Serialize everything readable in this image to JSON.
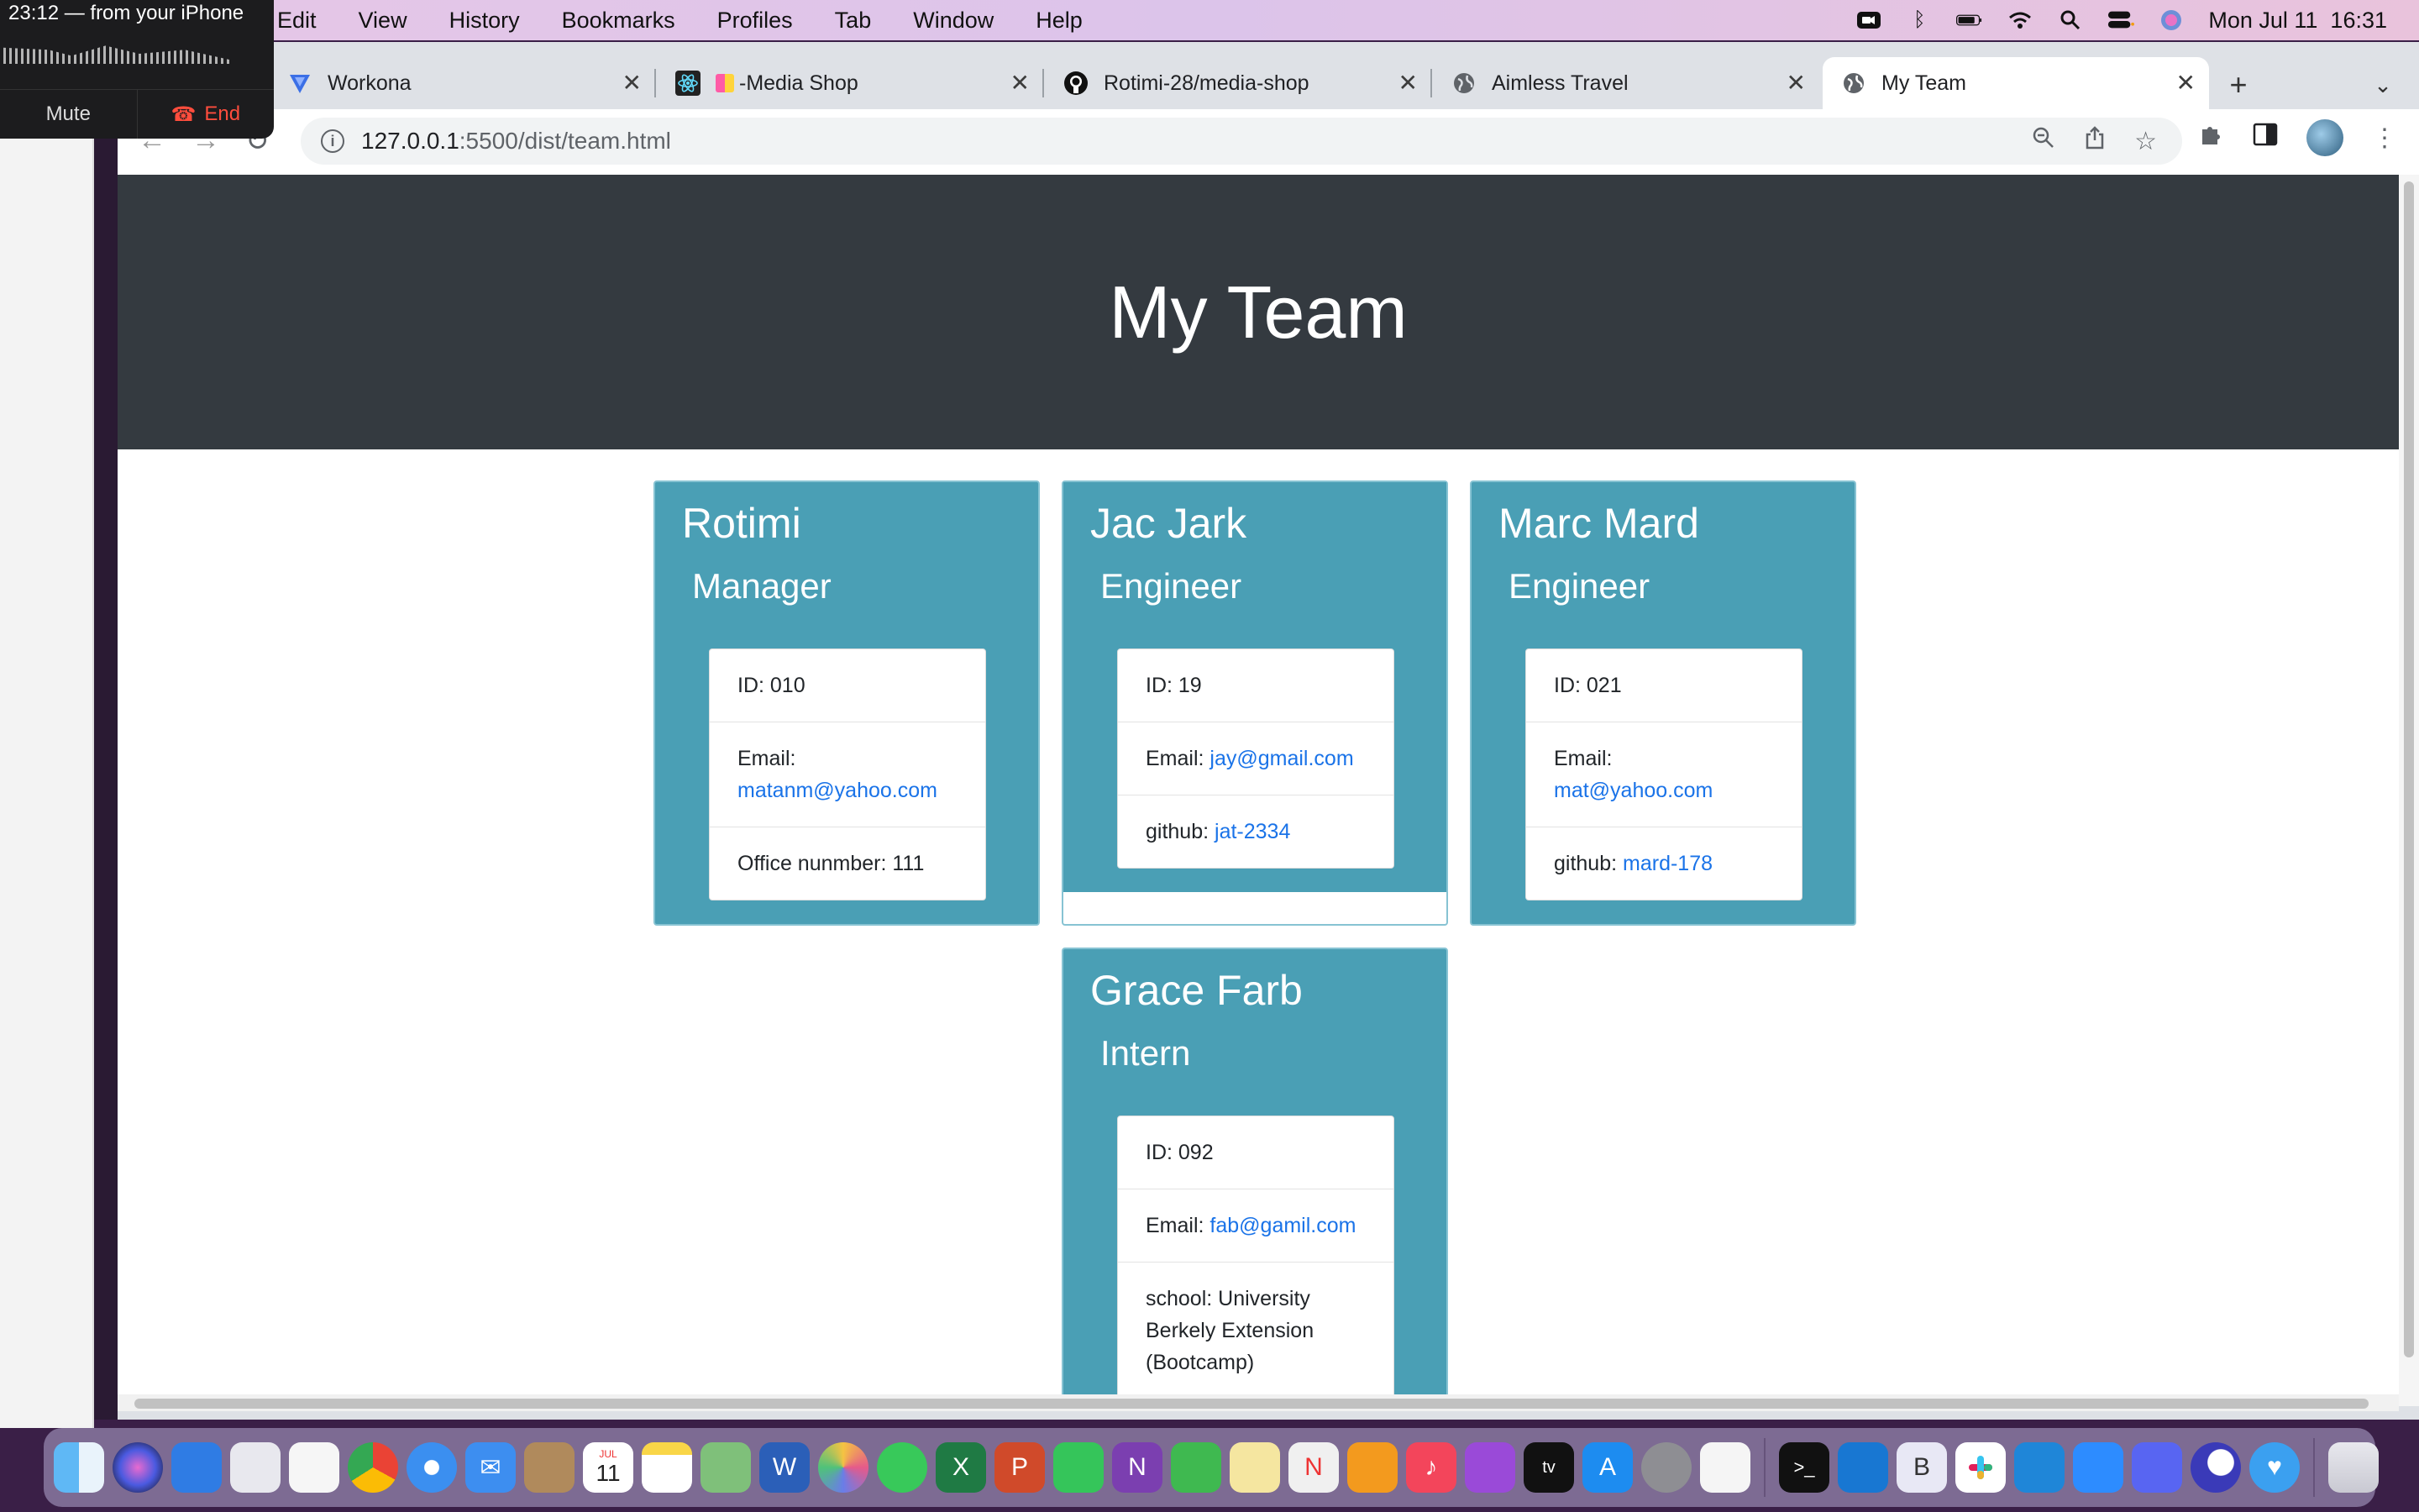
{
  "call": {
    "title": "23:12 — from your iPhone",
    "mute_label": "Mute",
    "end_label": "End"
  },
  "menubar": {
    "items": [
      "Edit",
      "View",
      "History",
      "Bookmarks",
      "Profiles",
      "Tab",
      "Window",
      "Help"
    ],
    "clock": "Mon Jul 11  16:31"
  },
  "browser": {
    "tabs": [
      {
        "title": "Workona",
        "icon": "workona-icon"
      },
      {
        "title": "-Media Shop",
        "icon": "react-icon"
      },
      {
        "title": "Rotimi-28/media-shop",
        "icon": "github-icon"
      },
      {
        "title": "Aimless Travel",
        "icon": "globe-icon"
      },
      {
        "title": "My Team",
        "icon": "globe-icon",
        "active": true
      }
    ],
    "url_host": "127.0.0.1",
    "url_path": ":5500/dist/team.html"
  },
  "page": {
    "header": "My Team",
    "cards": [
      {
        "name": "Rotimi",
        "role": "Manager",
        "id_text": "ID: 010",
        "email_label": "Email: ",
        "email": "matanm@yahoo.com",
        "extra_label": "Office nunmber: 111",
        "extra_link": ""
      },
      {
        "name": "Jac Jark",
        "role": "Engineer",
        "id_text": "ID: 19",
        "email_label": "Email: ",
        "email": "jay@gmail.com",
        "extra_label": "github: ",
        "extra_link": "jat-2334"
      },
      {
        "name": "Marc Mard",
        "role": "Engineer",
        "id_text": "ID: 021",
        "email_label": "Email: ",
        "email": "mat@yahoo.com",
        "extra_label": "github: ",
        "extra_link": "mard-178"
      },
      {
        "name": "Grace Farb",
        "role": "Intern",
        "id_text": "ID: 092",
        "email_label": "Email: ",
        "email": "fab@gamil.com",
        "extra_label": "school: University Berkely Extension (Bootcamp)",
        "extra_link": ""
      }
    ]
  },
  "dock": {
    "calendar_month": "JUL",
    "calendar_day": "11"
  },
  "colors": {
    "header_bg": "#343a40",
    "card_bg": "#4a9fb5",
    "link": "#1a73e8"
  }
}
